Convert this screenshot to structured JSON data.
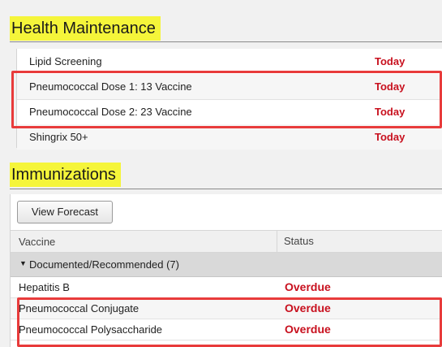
{
  "health_maintenance": {
    "title": "Health Maintenance",
    "items": [
      {
        "name": "Lipid Screening",
        "due": "Today"
      },
      {
        "name": "Pneumococcal Dose 1: 13 Vaccine",
        "due": "Today"
      },
      {
        "name": "Pneumococcal Dose 2: 23 Vaccine",
        "due": "Today"
      },
      {
        "name": "Shingrix 50+",
        "due": "Today"
      }
    ]
  },
  "immunizations": {
    "title": "Immunizations",
    "view_forecast_label": "View Forecast",
    "columns": [
      "Vaccine",
      "Status"
    ],
    "group_label": "Documented/Recommended (7)",
    "rows": [
      {
        "vaccine": "Hepatitis B",
        "status": "Overdue"
      },
      {
        "vaccine": "Pneumococcal Conjugate",
        "status": "Overdue"
      },
      {
        "vaccine": "Pneumococcal Polysaccharide",
        "status": "Overdue"
      }
    ]
  },
  "colors": {
    "highlight_yellow": "#f5f53a",
    "annotation_red": "#e83b3b",
    "status_red": "#c8101e"
  },
  "icons": {
    "group_toggle": "caret-down-icon"
  }
}
